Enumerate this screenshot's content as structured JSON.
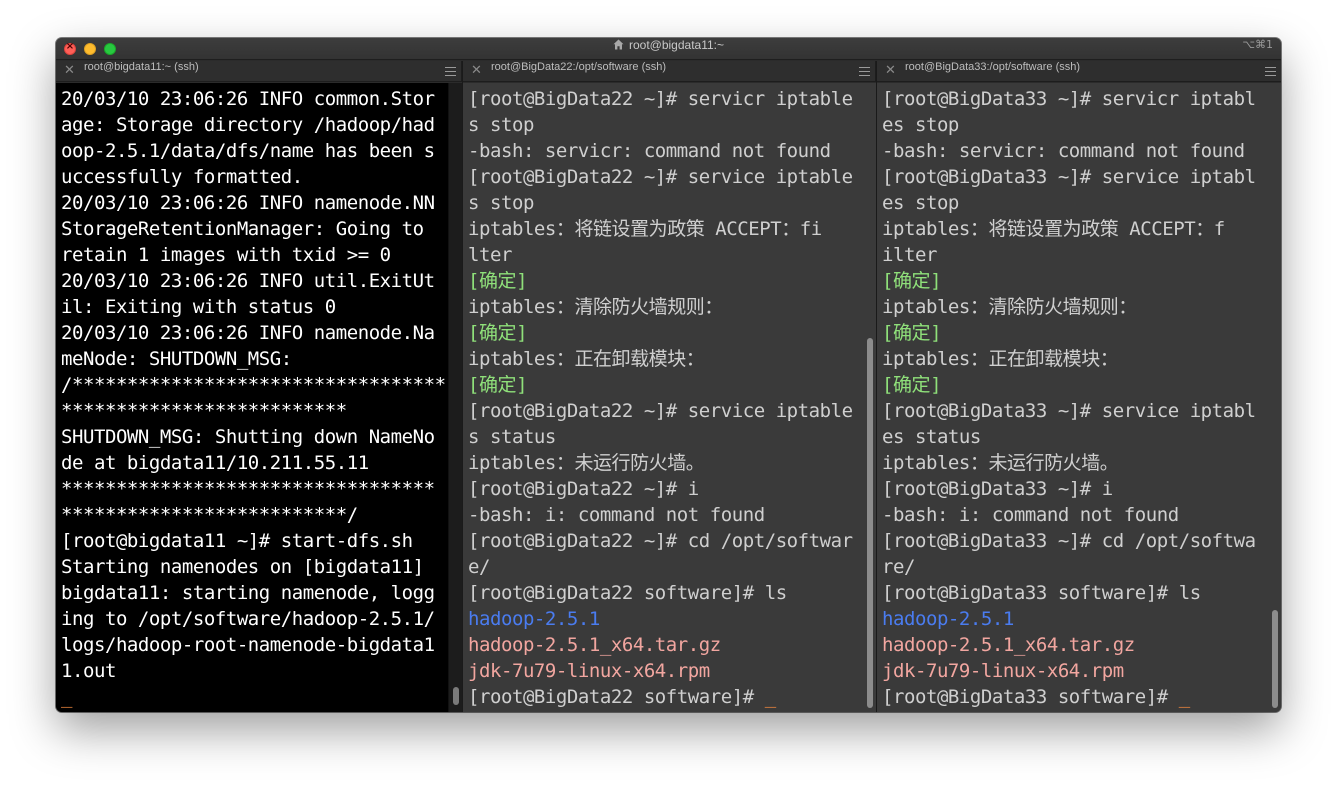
{
  "window": {
    "title": "root@bigdata11:~",
    "shortcut": "⌥⌘1"
  },
  "tabs": [
    {
      "label": "root@bigdata11:~ (ssh)"
    },
    {
      "label": "root@BigData22:/opt/software (ssh)"
    },
    {
      "label": "root@BigData33:/opt/software (ssh)"
    }
  ],
  "panes": {
    "pane1": {
      "lines": [
        "20/03/10 23:06:26 INFO common.Stor",
        "age: Storage directory /hadoop/had",
        "oop-2.5.1/data/dfs/name has been s",
        "uccessfully formatted.",
        "20/03/10 23:06:26 INFO namenode.NN",
        "StorageRetentionManager: Going to",
        "retain 1 images with txid >= 0",
        "20/03/10 23:06:26 INFO util.ExitUt",
        "il: Exiting with status 0",
        "20/03/10 23:06:26 INFO namenode.Na",
        "meNode: SHUTDOWN_MSG:",
        "/**********************************",
        "**************************",
        "SHUTDOWN_MSG: Shutting down NameNo",
        "de at bigdata11/10.211.55.11",
        "**********************************",
        "**************************/",
        "[root@bigdata11 ~]# start-dfs.sh",
        "Starting namenodes on [bigdata11]",
        "bigdata11: starting namenode, logg",
        "ing to /opt/software/hadoop-2.5.1/",
        "logs/hadoop-root-namenode-bigdata1",
        "1.out",
        ""
      ],
      "cursor": "_"
    },
    "pane2": {
      "lines": [
        "[root@BigData22 ~]# servicr iptable",
        "s stop",
        "-bash: servicr: command not found",
        "[root@BigData22 ~]# service iptable",
        "s stop",
        "iptables：将链设置为政策 ACCEPT：fi",
        "lter",
        "[确定]",
        "iptables：清除防火墙规则：",
        "[确定]",
        "iptables：正在卸载模块：",
        "[确定]",
        "[root@BigData22 ~]# service iptable",
        "s status",
        "iptables：未运行防火墙。",
        "[root@BigData22 ~]# i",
        "-bash: i: command not found",
        "[root@BigData22 ~]# cd /opt/softwar",
        "e/",
        "[root@BigData22 software]# ls",
        "hadoop-2.5.1",
        "hadoop-2.5.1_x64.tar.gz",
        "jdk-7u79-linux-x64.rpm",
        "[root@BigData22 software]# "
      ],
      "cursor": "_"
    },
    "pane3": {
      "lines": [
        "[root@BigData33 ~]# servicr iptabl",
        "es stop",
        "-bash: servicr: command not found",
        "[root@BigData33 ~]# service iptabl",
        "es stop",
        "iptables：将链设置为政策 ACCEPT：f",
        "ilter",
        "[确定]",
        "iptables：清除防火墙规则：",
        "[确定]",
        "iptables：正在卸载模块：",
        "[确定]",
        "[root@BigData33 ~]# service iptabl",
        "es status",
        "iptables：未运行防火墙。",
        "[root@BigData33 ~]# i",
        "-bash: i: command not found",
        "[root@BigData33 ~]# cd /opt/softwa",
        "re/",
        "[root@BigData33 software]# ls",
        "hadoop-2.5.1",
        "hadoop-2.5.1_x64.tar.gz",
        "jdk-7u79-linux-x64.rpm",
        "[root@BigData33 software]# "
      ],
      "cursor": "_"
    }
  },
  "colors": {
    "ok_green": "#8fe07a",
    "dir_blue": "#4a7cf0",
    "archive_pink": "#f2a6a0",
    "cursor_orange": "#f0883e"
  }
}
